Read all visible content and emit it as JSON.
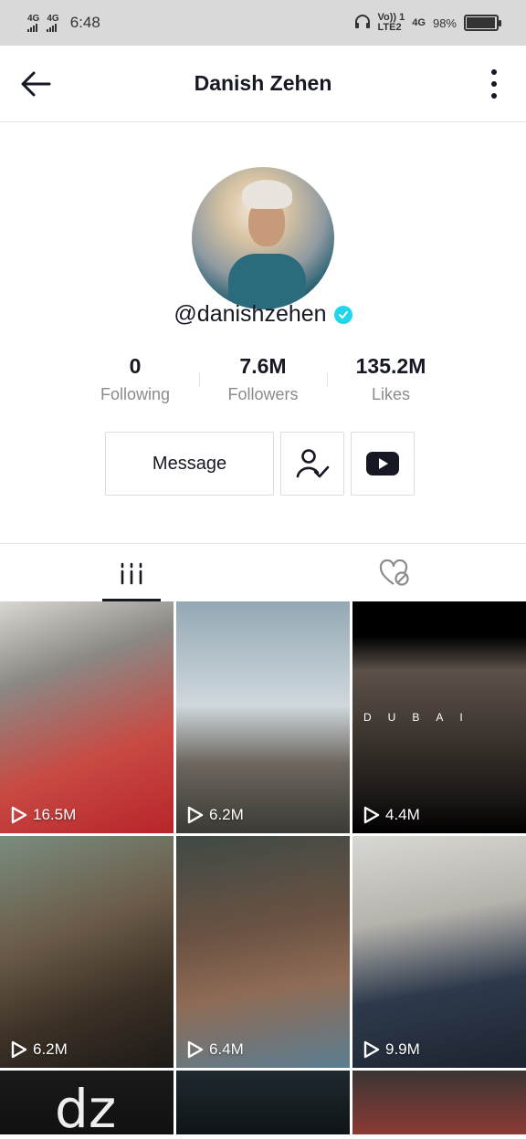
{
  "status_bar": {
    "network_1": "4G",
    "network_2": "4G",
    "time": "6:48",
    "carrier_1": "Vo)) 1",
    "carrier_2": "LTE2",
    "network_3": "4G",
    "battery": "98%"
  },
  "header": {
    "title": "Danish Zehen"
  },
  "profile": {
    "username": "@danishzehen",
    "verified": true
  },
  "stats": [
    {
      "value": "0",
      "label": "Following"
    },
    {
      "value": "7.6M",
      "label": "Followers"
    },
    {
      "value": "135.2M",
      "label": "Likes"
    }
  ],
  "actions": {
    "message_label": "Message",
    "follow_icon": "user-check-icon",
    "youtube_icon": "youtube-icon"
  },
  "tabs": [
    {
      "icon": "videos-grid-icon",
      "active": true
    },
    {
      "icon": "liked-hidden-icon",
      "active": false
    }
  ],
  "videos": [
    {
      "views": "16.5M"
    },
    {
      "views": "6.2M"
    },
    {
      "views": "4.4M",
      "caption": "DUBAI"
    },
    {
      "views": "6.2M"
    },
    {
      "views": "6.4M"
    },
    {
      "views": "9.9M"
    },
    {
      "views": ""
    },
    {
      "views": ""
    },
    {
      "views": ""
    }
  ],
  "colors": {
    "verified": "#20d5ec",
    "text": "#161823",
    "muted": "#8a8b91"
  }
}
